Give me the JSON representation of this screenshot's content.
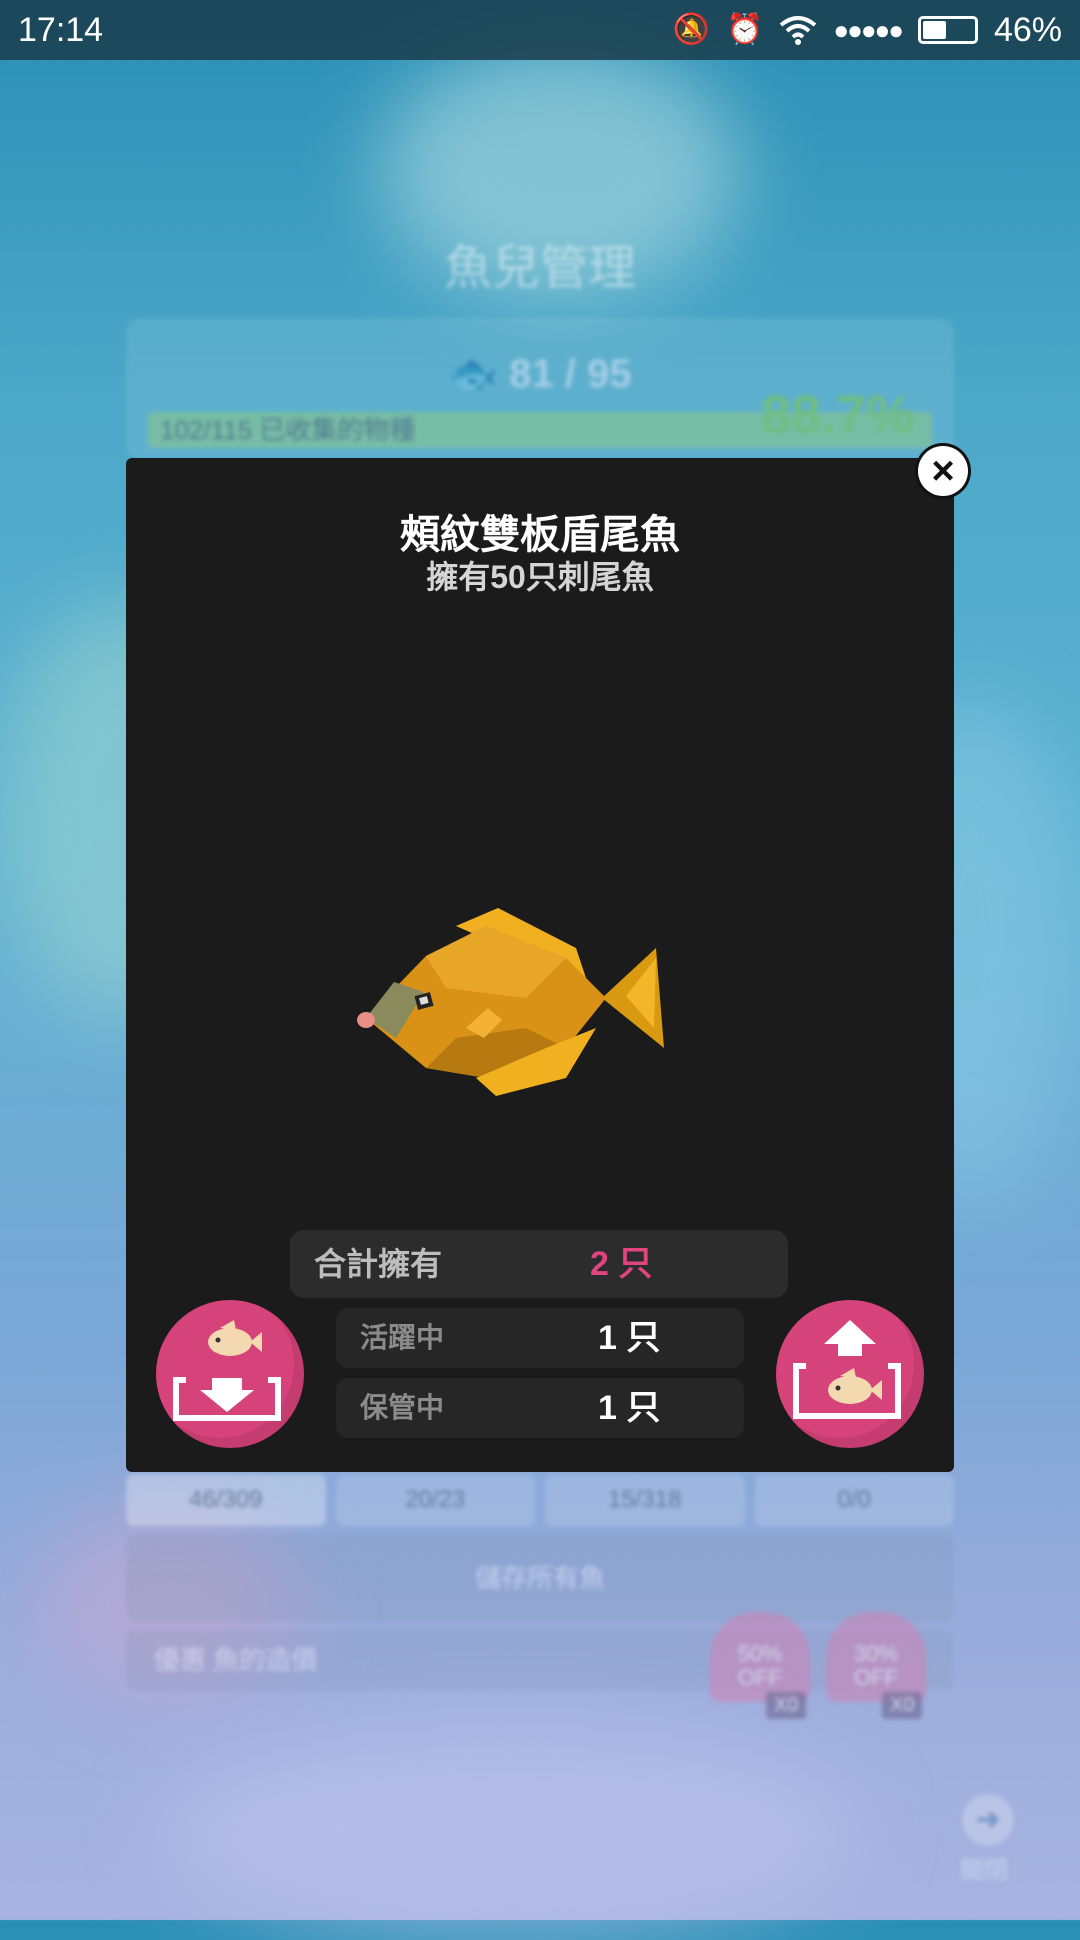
{
  "status_bar": {
    "time": "17:14",
    "icons": [
      "bell-muted-icon",
      "alarm-icon",
      "wifi-icon",
      "signal-dots-icon",
      "battery-icon"
    ],
    "signal": "●●●●●",
    "battery_percent": "46%",
    "battery_level": 0.46
  },
  "background": {
    "title": "魚兒管理",
    "fish_count": "81 / 95",
    "collection_text": "102/115 已收集的物種",
    "collection_percent": "88.7%",
    "tabs": [
      "46/309",
      "20/23",
      "15/318",
      "0/0"
    ],
    "save_all_label": "儲存所有魚",
    "discount_label": "優惠 魚的造價",
    "coupons": [
      {
        "label": "50%\nOFF",
        "count": "X0"
      },
      {
        "label": "30%\nOFF",
        "count": "X0"
      }
    ],
    "close_label": "關閉"
  },
  "modal": {
    "fish_name": "頰紋雙板盾尾魚",
    "subtitle": "擁有50只刺尾魚",
    "total_label": "合計擁有",
    "total_value": "2 只",
    "active_label": "活躍中",
    "active_value": "1 只",
    "stored_label": "保管中",
    "stored_value": "1 只",
    "close_icon": "×"
  },
  "colors": {
    "accent_pink": "#d6427a",
    "modal_bg": "#1b1b1b",
    "fish_body": "#e0a020"
  }
}
